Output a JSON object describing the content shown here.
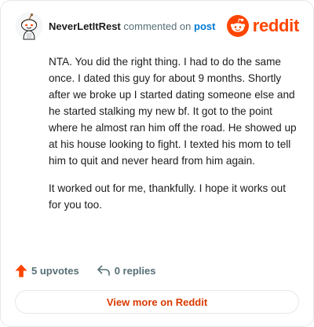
{
  "header": {
    "username": "NeverLetItRest",
    "commented_text": "commented on",
    "post_link": "post",
    "brand": "reddit"
  },
  "comment": {
    "paragraphs": [
      "NTA. You did the right thing. I had to do the same once. I dated this guy for about 9 months. Shortly after we broke up I started dating someone else and he started stalking my new bf. It got to the point where he almost ran him off the road. He showed up at his house looking to fight. I texted his mom to tell him to quit and never heard from him again.",
      "It worked out for me, thankfully. I hope it works out for you too."
    ]
  },
  "actions": {
    "upvotes": "5 upvotes",
    "replies": "0 replies"
  },
  "footer": {
    "view_more": "View more on Reddit"
  },
  "colors": {
    "brand": "#ff4500",
    "upvote": "#ff4500",
    "link": "#0079d3",
    "view_more_text": "#d93a00"
  },
  "icons": {
    "avatar": "snoo-avatar-icon",
    "logo": "reddit-alien-icon",
    "upvote": "upvote-arrow-icon",
    "reply": "reply-arrow-icon"
  }
}
